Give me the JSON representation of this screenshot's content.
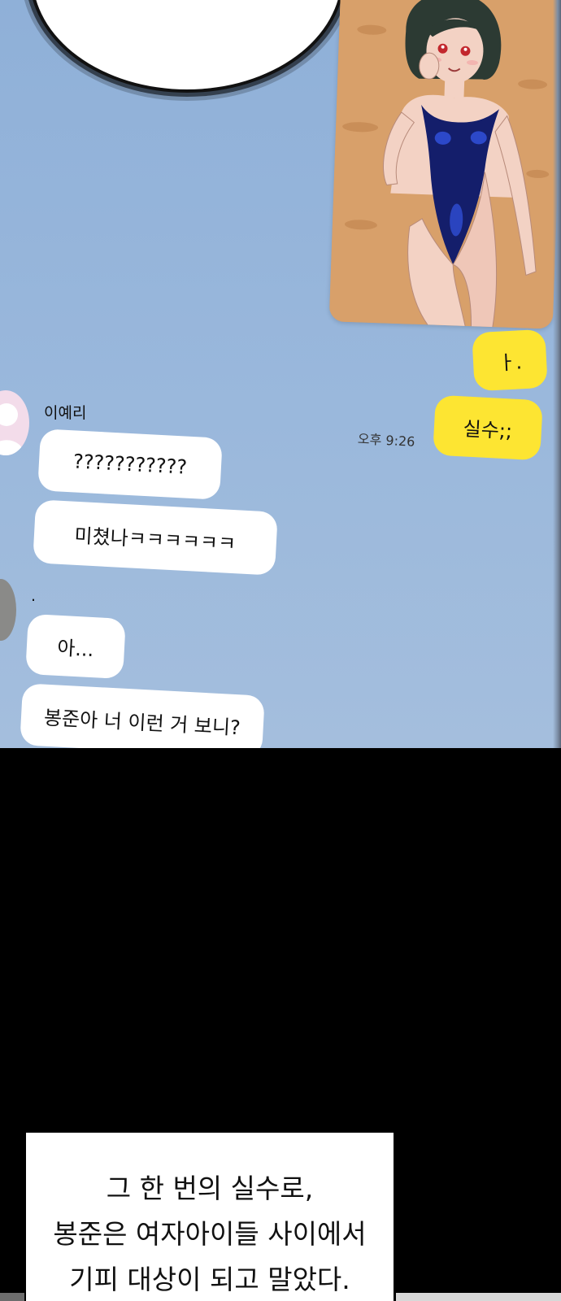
{
  "chat": {
    "my_messages": [
      "ㅏ.",
      "실수;;"
    ],
    "timestamp": "오후 9:26",
    "contact_1": {
      "name": "이예리",
      "messages": [
        "???????????",
        "미쳤나ㅋㅋㅋㅋㅋㅋ"
      ]
    },
    "contact_2": {
      "name": ".",
      "messages": [
        "아...",
        "봉준아 너 이런 거 보니?"
      ]
    }
  },
  "caption": {
    "lines": [
      "그 한 번의 실수로,",
      "봉준은 여자아이들 사이에서",
      "기피 대상이 되고 말았다."
    ]
  },
  "colors": {
    "chat_background": "#9ab8dc",
    "my_bubble": "#fde532",
    "their_bubble": "#ffffff",
    "page_background": "#000000"
  }
}
